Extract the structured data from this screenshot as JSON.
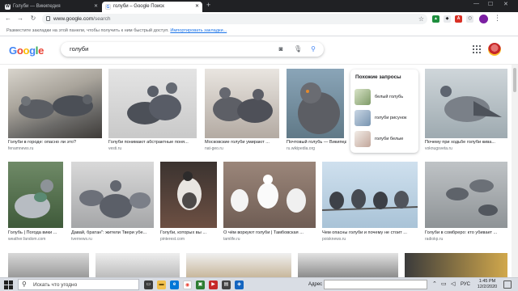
{
  "browser": {
    "tabs": [
      {
        "title": "Голуби — Википедия",
        "icon": "wikipedia-icon"
      },
      {
        "title": "голуби – Google Поиск",
        "icon": "google-icon"
      }
    ],
    "url_domain": "www.google.com",
    "url_path": "/search",
    "bookmarks_hint": "Разместите закладки на этой панели, чтобы получить к ним быстрый доступ.",
    "bookmarks_import": "Импортировать закладки..."
  },
  "google": {
    "logo": "Google",
    "query": "голуби"
  },
  "results": [
    {
      "caption": "Голуби в городе: опасно ли это?",
      "source": "fenamnews.ru"
    },
    {
      "caption": "Голуби понимают абстрактные поня...",
      "source": "vesti.ru"
    },
    {
      "caption": "Московские голуби умирают ...",
      "source": "nat-geo.ru"
    },
    {
      "caption": "Почтовый голубь — Википедия",
      "source": "ru.wikipedia.org"
    },
    {
      "caption": "Почему при ходьбе голуби кива...",
      "source": "voknugsveta.ru"
    },
    {
      "caption": "Голубь | Погода вики ...",
      "source": "weather.fandom.com"
    },
    {
      "caption": "Давай, братан\": жители Твери убе...",
      "source": "tvernews.ru"
    },
    {
      "caption": "Голуби, которых вы ...",
      "source": "pinterest.com"
    },
    {
      "caption": "О чём воркуют голуби | Тамбовская ...",
      "source": "tamlife.ru"
    },
    {
      "caption": "Чем опасны голуби и почему не стоит ...",
      "source": "poisknews.ru"
    },
    {
      "caption": "Голуби в сомбреро: кто убивает ...",
      "source": "radiokp.ru"
    }
  ],
  "related": {
    "title": "Похожие запросы",
    "items": [
      "белый голубь",
      "голуби рисунок",
      "голуби белые"
    ]
  },
  "taskbar": {
    "search_placeholder": "Искать что угодно",
    "address_label": "Адрес",
    "language": "РУС",
    "time": "1:45 PM",
    "date": "12/2/2020"
  },
  "colors": {
    "accent": "#1a73e8",
    "tab_strip": "#202124",
    "taskbar": "#d9dde4"
  }
}
